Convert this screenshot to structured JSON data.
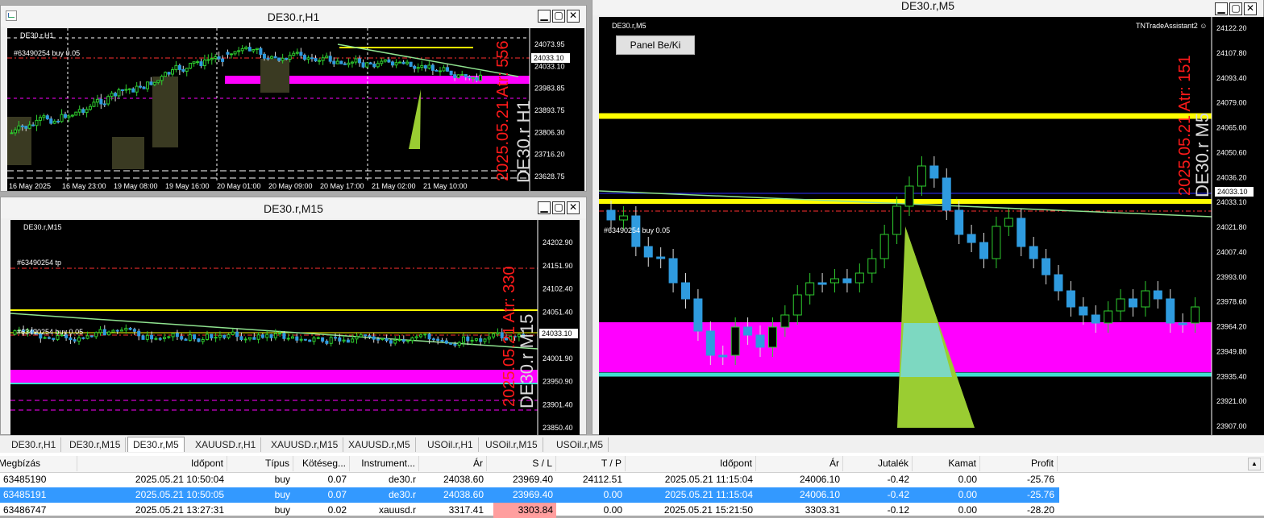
{
  "windows": {
    "h1": {
      "title": "DE30.r,H1",
      "symbol": "DE30.r,H1",
      "order_label": "#63490254 buy 0.05",
      "price_labels": [
        "24073.95",
        "24033.10",
        "23983.85",
        "23893.75",
        "23806.30",
        "23716.20",
        "23628.75"
      ],
      "current_price": "24033.10",
      "time_labels": [
        "16 May 2025",
        "16 May 23:00",
        "19 May 08:00",
        "19 May 16:00",
        "20 May 01:00",
        "20 May 09:00",
        "20 May 17:00",
        "21 May 02:00",
        "21 May 10:00"
      ],
      "overlay_red": "2025.05.21 Atr: 556",
      "overlay_name": "DE30.r H1"
    },
    "m15": {
      "title": "DE30.r,M15",
      "symbol": "DE30.r,M15",
      "tp_label": "#63490254 tp",
      "order_label": "#63490254 buy 0.05",
      "price_labels": [
        "24202.90",
        "24151.90",
        "24102.40",
        "24051.40",
        "24033.10",
        "24001.90",
        "23950.90",
        "23901.40",
        "23850.40"
      ],
      "current_price": "24033.10",
      "overlay_red": "2025.05.21 Atr: 330",
      "overlay_name": "DE30.r M15"
    },
    "m5": {
      "title": "DE30.r,M5",
      "symbol": "DE30.r,M5",
      "assistant": "TNTradeAssistant2 ☺",
      "panel_button": "Panel Be/Ki",
      "order_label": "#63490254 buy 0.05",
      "price_labels": [
        "24122.20",
        "24107.80",
        "24093.40",
        "24079.00",
        "24065.00",
        "24050.60",
        "24036.20",
        "24033.10",
        "24021.80",
        "24007.40",
        "23993.00",
        "23978.60",
        "23964.20",
        "23949.80",
        "23935.40",
        "23921.00",
        "23907.00"
      ],
      "current_price": "24033.10",
      "overlay_red": "2025.05.21 Atr: 151",
      "overlay_name": "DE30.r M5"
    }
  },
  "window_buttons": {
    "minimize": "▁",
    "restore": "▢",
    "close": "✕"
  },
  "tabs": [
    "DE30.r,H1",
    "DE30.r,M15",
    "DE30.r,M5",
    "XAUUSD.r,H1",
    "XAUUSD.r,M15",
    "XAUUSD.r,M5",
    "USOil.r,H1",
    "USOil.r,M15",
    "USOil.r,M5"
  ],
  "active_tab": 2,
  "terminal": {
    "columns": [
      "Megbízás",
      "Időpont",
      "Típus",
      "Kötéseg...",
      "Instrument...",
      "Ár",
      "S / L",
      "T / P",
      "Időpont",
      "Ár",
      "Jutalék",
      "Kamat",
      "Profit"
    ],
    "rows": [
      [
        "63485190",
        "2025.05.21 10:50:04",
        "buy",
        "0.07",
        "de30.r",
        "24038.60",
        "23969.40",
        "24112.51",
        "2025.05.21 11:15:04",
        "24006.10",
        "-0.42",
        "0.00",
        "-25.76"
      ],
      [
        "63485191",
        "2025.05.21 10:50:05",
        "buy",
        "0.07",
        "de30.r",
        "24038.60",
        "23969.40",
        "0.00",
        "2025.05.21 11:15:04",
        "24006.10",
        "-0.42",
        "0.00",
        "-25.76"
      ],
      [
        "63486747",
        "2025.05.21 13:27:31",
        "buy",
        "0.02",
        "xauusd.r",
        "3317.41",
        "3303.84",
        "0.00",
        "2025.05.21 15:21:50",
        "3303.31",
        "-0.12",
        "0.00",
        "-28.20"
      ]
    ],
    "selected_row": 1
  },
  "colors": {
    "bull": "#2ecc2e",
    "bear": "#2f9bdf",
    "magenta": "#ff00ff",
    "yellow": "#ffff00",
    "cyan": "#40e0d0",
    "lime": "#9acd32",
    "selection": "#3399ff"
  }
}
